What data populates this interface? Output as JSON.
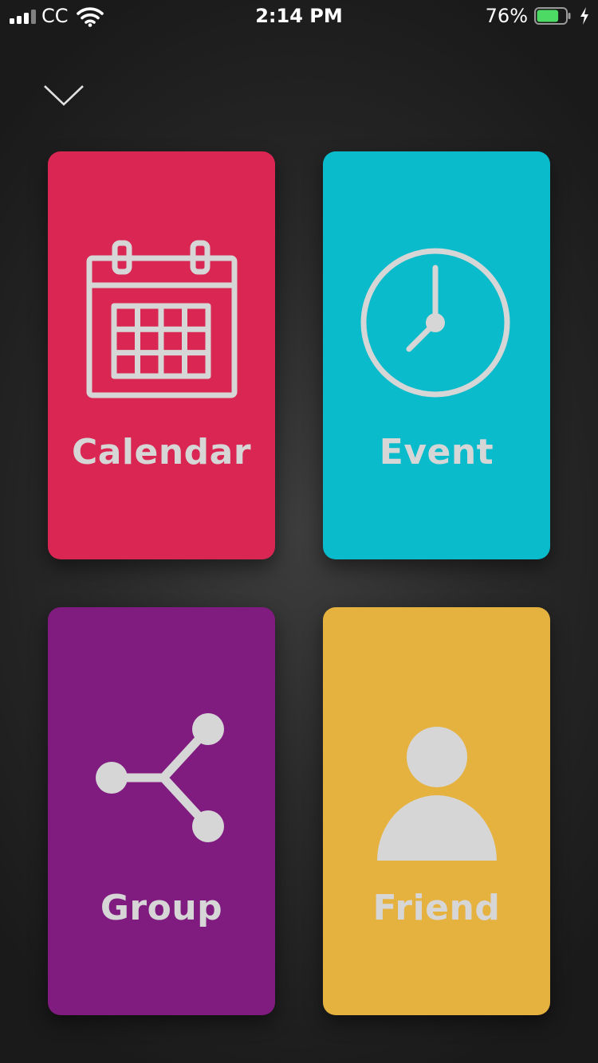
{
  "status_bar": {
    "carrier": "CC",
    "time": "2:14 PM",
    "battery_percent": "76%",
    "battery_level": 0.76,
    "battery_color": "#4cd964",
    "icons": [
      "signal-icon",
      "wifi-icon",
      "battery-icon",
      "charging-bolt-icon"
    ]
  },
  "header": {
    "collapse_icon": "chevron-down-icon"
  },
  "tiles": [
    {
      "label": "Calendar",
      "icon": "calendar-icon",
      "color": "#d92653"
    },
    {
      "label": "Event",
      "icon": "clock-icon",
      "color": "#0abccb"
    },
    {
      "label": "Group",
      "icon": "share-icon",
      "color": "#801c80"
    },
    {
      "label": "Friend",
      "icon": "person-icon",
      "color": "#e6b23f"
    }
  ]
}
